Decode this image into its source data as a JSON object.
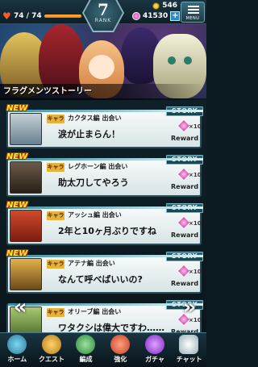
{
  "status": {
    "stamina_text": "74 / 74",
    "stamina_fraction": 1.0,
    "rank_value": "7",
    "rank_label": "RANK",
    "coins": "546",
    "gems": "41530",
    "plus_label": "+",
    "menu_label": "MENU"
  },
  "banner": {
    "title": "フラグメンツストーリー"
  },
  "story": {
    "new_label": "NEW",
    "chara_label": "キャラ",
    "button_label": "STORY",
    "reward_label": "Reward",
    "reward_count": "×10",
    "items": [
      {
        "chapter": "カクタス編 出会い",
        "line": "涙が止まらん！"
      },
      {
        "chapter": "レグホーン編 出会い",
        "line": "助太刀してやろう"
      },
      {
        "chapter": "アッシュ編 出会い",
        "line": "2年と10ヶ月ぶりですね"
      },
      {
        "chapter": "アテナ編 出会い",
        "line": "なんて呼べばいいの?"
      },
      {
        "chapter": "オリーブ編 出会い",
        "line": "ワタクシは偉大ですわ……"
      }
    ]
  },
  "nav": {
    "items": [
      {
        "label": "ホーム",
        "icon": "home-icon"
      },
      {
        "label": "クエスト",
        "icon": "quest-icon"
      },
      {
        "label": "編成",
        "icon": "party-icon"
      },
      {
        "label": "強化",
        "icon": "enhance-icon"
      },
      {
        "label": "ガチャ",
        "icon": "gacha-icon"
      },
      {
        "label": "チャット",
        "icon": "chat-icon"
      }
    ]
  },
  "colors": {
    "accent": "#2a6a7a",
    "new_badge": "#ffec3a",
    "chara_tag": "#e6b23a",
    "gem": "#d03aa8"
  }
}
